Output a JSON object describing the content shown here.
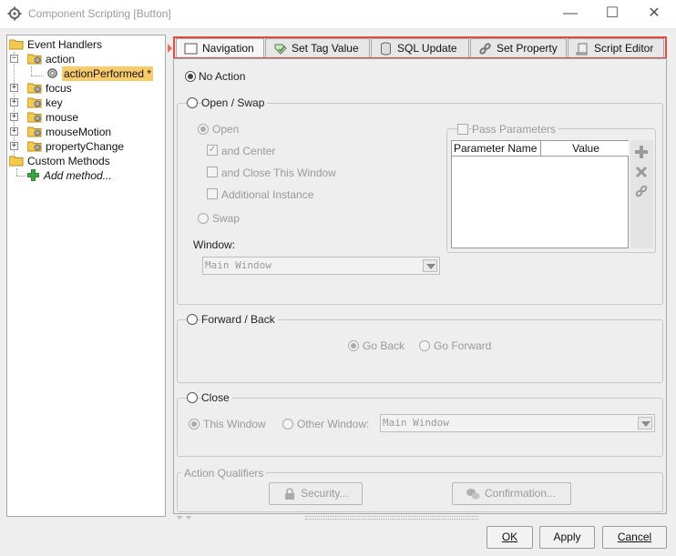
{
  "window": {
    "title": "Component Scripting [Button]",
    "controls": {
      "minimize": "—",
      "maximize": "☐",
      "close": "✕"
    }
  },
  "tree": {
    "root": "Event Handlers",
    "action": "action",
    "action_performed": "actionPerformed *",
    "focus": "focus",
    "key": "key",
    "mouse": "mouse",
    "mouse_motion": "mouseMotion",
    "property_change": "propertyChange",
    "custom_methods": "Custom Methods",
    "add_method": "Add method..."
  },
  "tabs": [
    {
      "label": "Navigation",
      "icon": "window-icon",
      "active": true
    },
    {
      "label": "Set Tag Value",
      "icon": "tag-edit-icon"
    },
    {
      "label": "SQL Update",
      "icon": "database-icon"
    },
    {
      "label": "Set Property",
      "icon": "link-icon"
    },
    {
      "label": "Script Editor",
      "icon": "script-icon"
    }
  ],
  "navigation": {
    "no_action": "No Action",
    "open_swap": {
      "title": "Open / Swap",
      "open": "Open",
      "and_center": "and Center",
      "and_close": "and Close This Window",
      "additional_instance": "Additional Instance",
      "swap": "Swap",
      "window_label": "Window:",
      "window_value": "Main Window",
      "pass_parameters": "Pass Parameters",
      "param_columns": [
        "Parameter Name",
        "Value"
      ]
    },
    "forward_back": {
      "title": "Forward / Back",
      "go_back": "Go Back",
      "go_forward": "Go Forward"
    },
    "close": {
      "title": "Close",
      "this_window": "This Window",
      "other_window": "Other Window:",
      "other_window_value": "Main Window"
    },
    "qualifiers": {
      "title": "Action Qualifiers",
      "security": "Security...",
      "confirmation": "Confirmation..."
    }
  },
  "footer": {
    "ok": "OK",
    "apply": "Apply",
    "cancel": "Cancel"
  }
}
